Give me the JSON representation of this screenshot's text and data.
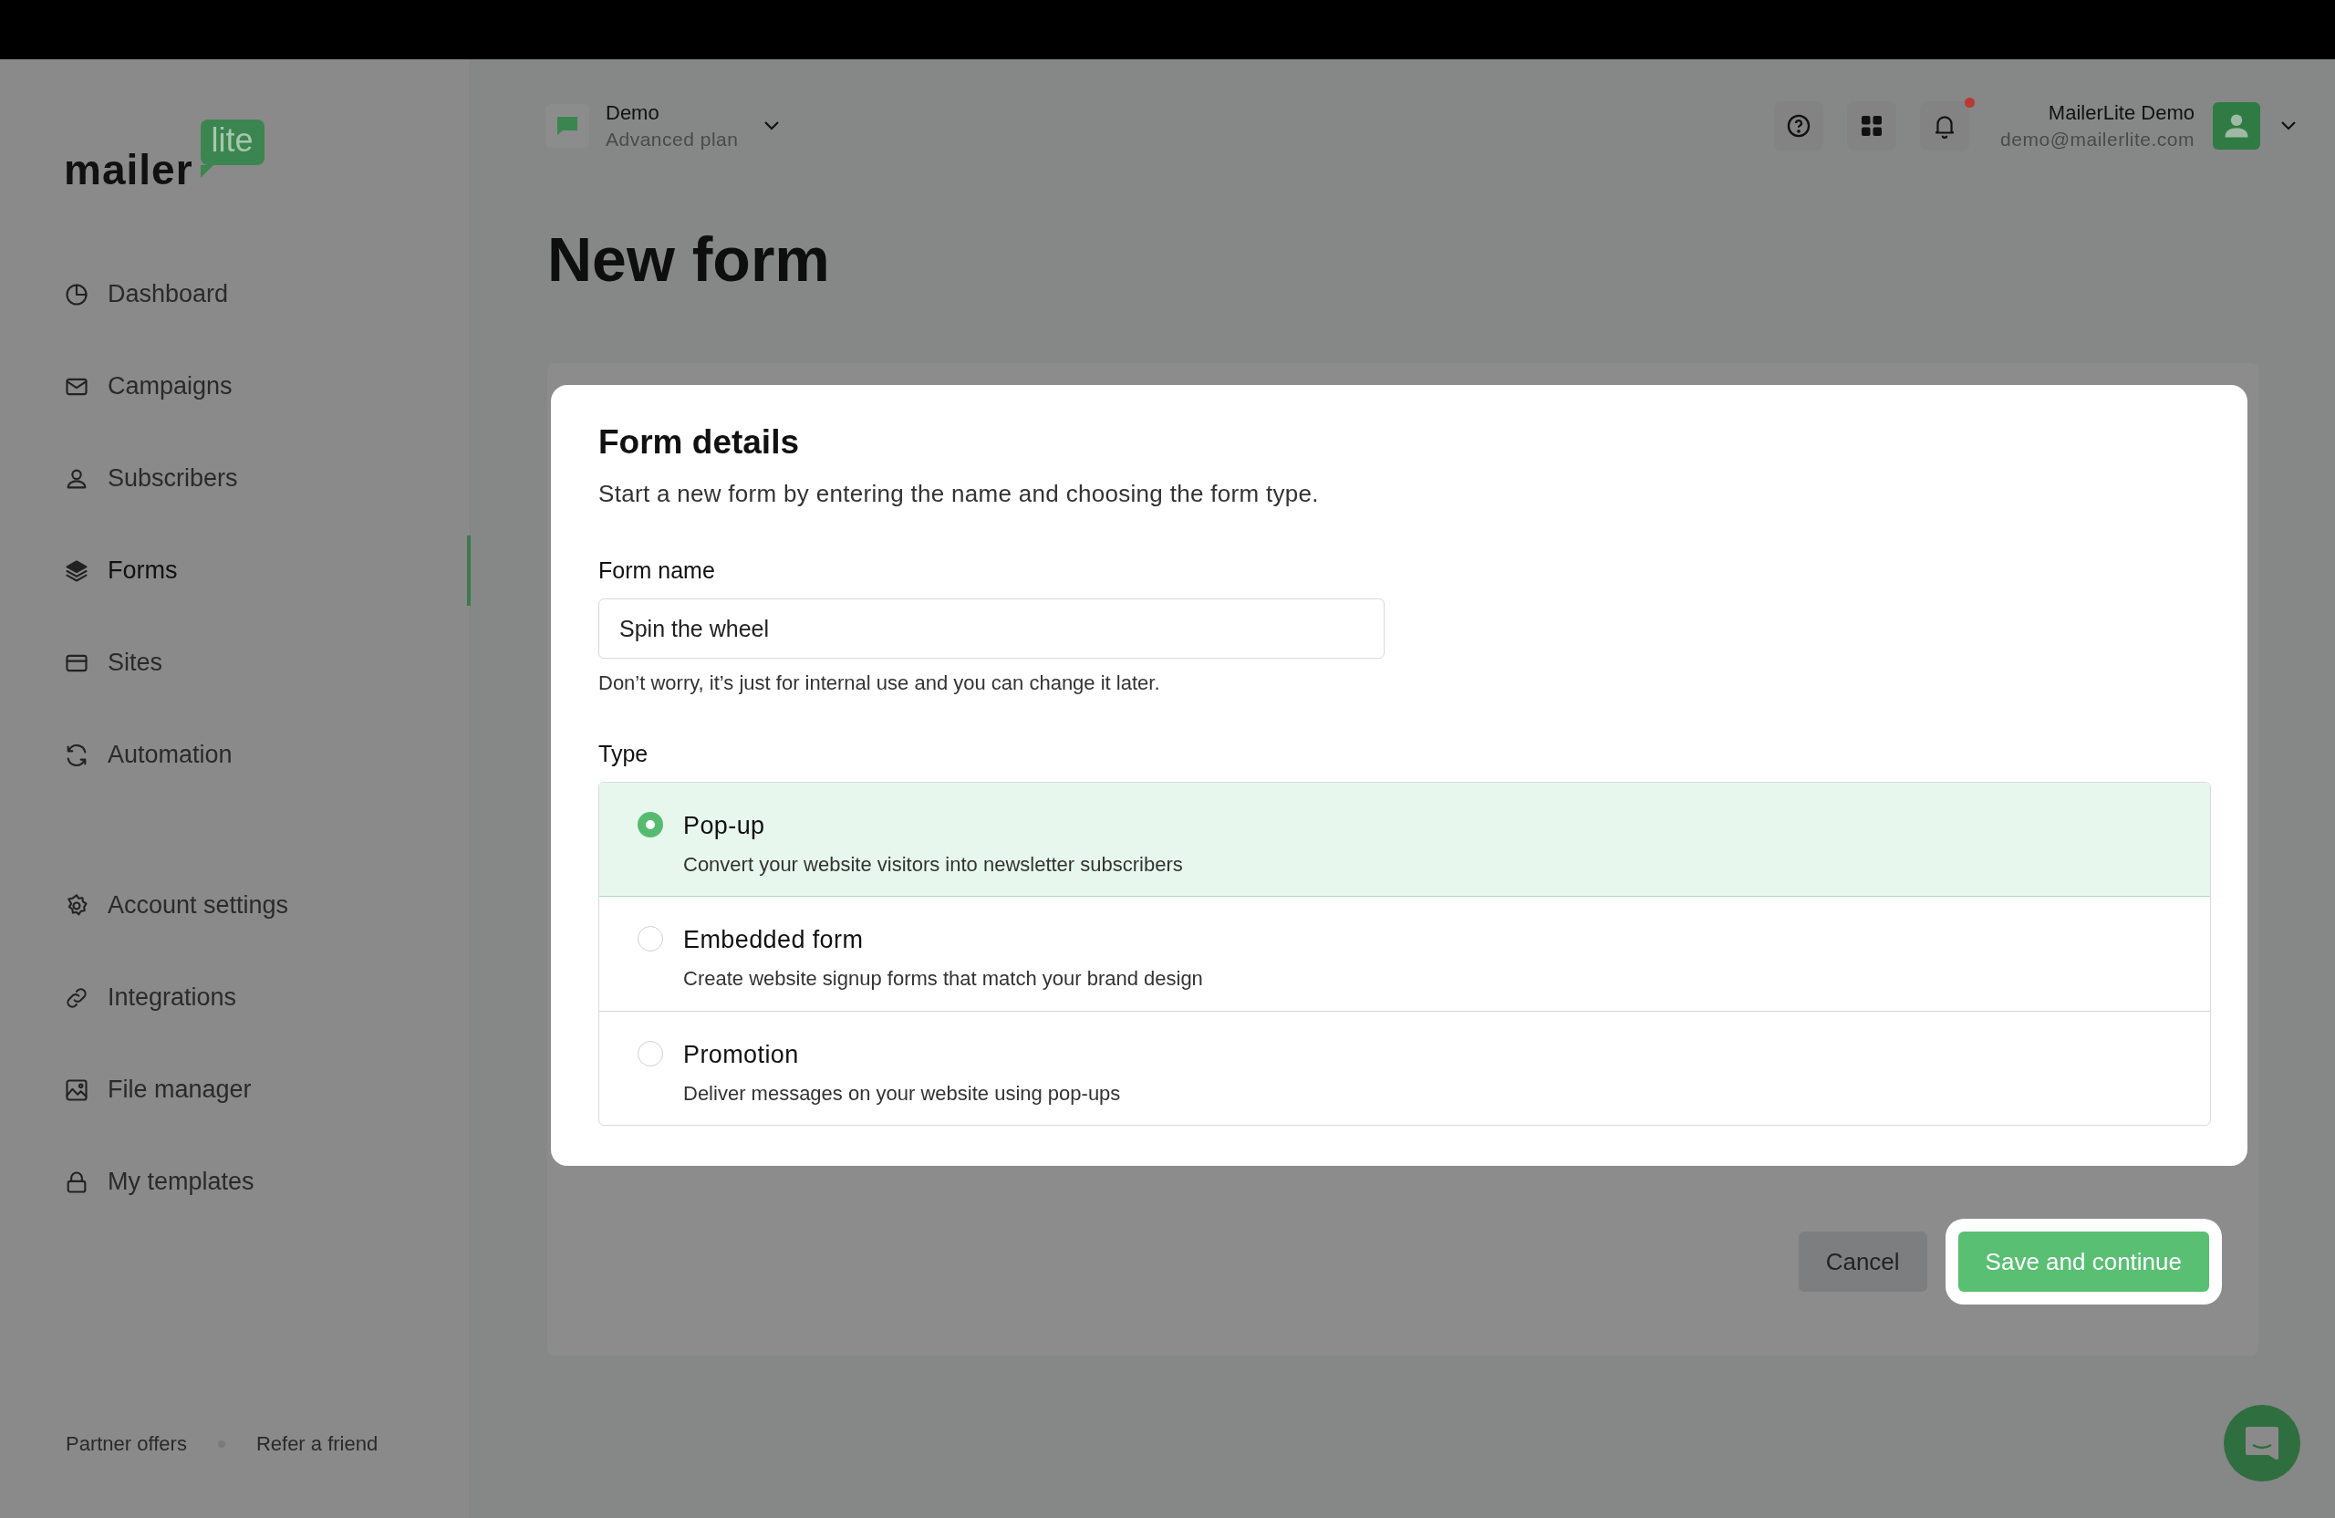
{
  "logo": {
    "word": "mailer",
    "badge": "lite"
  },
  "sidebar": {
    "items": [
      {
        "label": "Dashboard",
        "selected": false
      },
      {
        "label": "Campaigns",
        "selected": false
      },
      {
        "label": "Subscribers",
        "selected": false
      },
      {
        "label": "Forms",
        "selected": true
      },
      {
        "label": "Sites",
        "selected": false
      },
      {
        "label": "Automation",
        "selected": false
      }
    ],
    "settings_items": [
      {
        "label": "Account settings",
        "selected": false
      },
      {
        "label": "Integrations",
        "selected": false
      },
      {
        "label": "File manager",
        "selected": false
      },
      {
        "label": "My templates",
        "selected": false
      }
    ],
    "footer_links": [
      "Partner offers",
      "Refer a friend"
    ]
  },
  "header": {
    "workspace": {
      "name": "Demo",
      "plan": "Advanced plan"
    },
    "notifications": {
      "unread": true
    },
    "user": {
      "name": "MailerLite Demo",
      "email": "demo@mailerlite.com"
    }
  },
  "page": {
    "title": "New form"
  },
  "form_details": {
    "title": "Form details",
    "subtitle": "Start a new form by entering the name and choosing the form type.",
    "form_name": {
      "label": "Form name",
      "value": "Spin the wheel",
      "hint": "Don’t worry, it’s just for internal use and you can change it later."
    },
    "type": {
      "label": "Type",
      "options": [
        {
          "title": "Pop-up",
          "description": "Convert your website visitors into newsletter subscribers",
          "selected": true
        },
        {
          "title": "Embedded form",
          "description": "Create website signup forms that match your brand design",
          "selected": false
        },
        {
          "title": "Promotion",
          "description": "Deliver messages on your website using pop-ups",
          "selected": false
        }
      ]
    }
  },
  "buttons": [
    {
      "label": "Cancel",
      "kind": "secondary"
    },
    {
      "label": "Save and continue",
      "kind": "primary",
      "highlighted": true
    }
  ]
}
